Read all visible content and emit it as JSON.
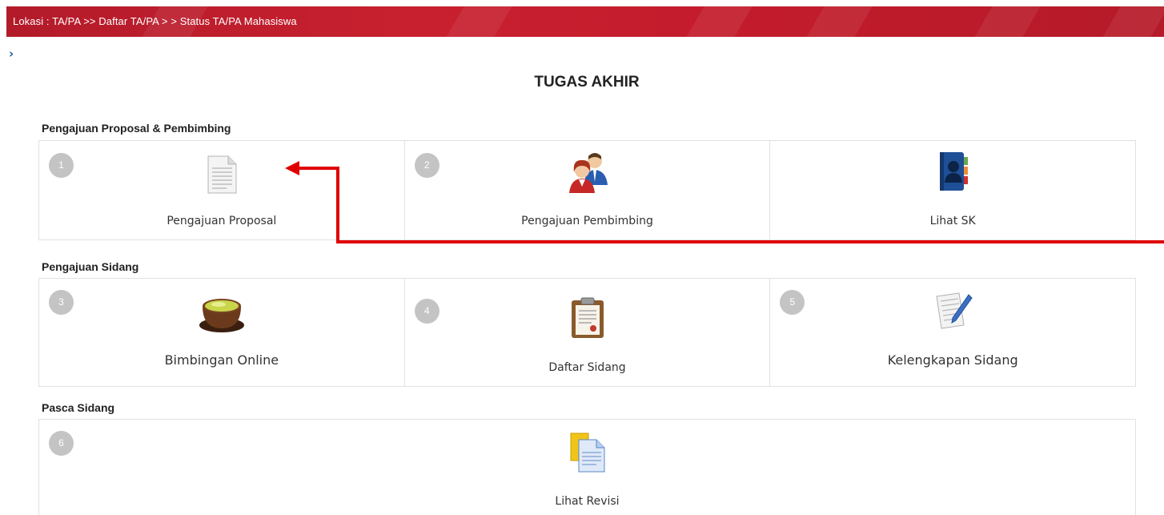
{
  "breadcrumb": "Lokasi : TA/PA >> Daftar TA/PA > > Status TA/PA Mahasiswa",
  "nav_toggle": "›",
  "page_title": "TUGAS AKHIR",
  "sections": [
    {
      "title": "Pengajuan Proposal & Pembimbing",
      "items": [
        {
          "number": "1",
          "label": "Pengajuan Proposal",
          "icon": "document-icon"
        },
        {
          "number": "2",
          "label": "Pengajuan Pembimbing",
          "icon": "users-icon"
        },
        {
          "number": "",
          "label": "Lihat SK",
          "icon": "contact-book-icon"
        }
      ]
    },
    {
      "title": "Pengajuan Sidang",
      "items": [
        {
          "number": "3",
          "label": "Bimbingan Online",
          "icon": "tea-cup-icon"
        },
        {
          "number": "4",
          "label": "Daftar Sidang",
          "icon": "clipboard-icon"
        },
        {
          "number": "5",
          "label": "Kelengkapan Sidang",
          "icon": "edit-document-icon"
        }
      ]
    },
    {
      "title": "Pasca Sidang",
      "items": [
        {
          "number": "6",
          "label": "Lihat Revisi",
          "icon": "documents-icon"
        }
      ]
    }
  ],
  "colors": {
    "header_bar": "#c41c2c",
    "number_badge": "#c4c4c4",
    "annotation_arrow": "#e00000",
    "chevron": "#1c5aa6"
  }
}
